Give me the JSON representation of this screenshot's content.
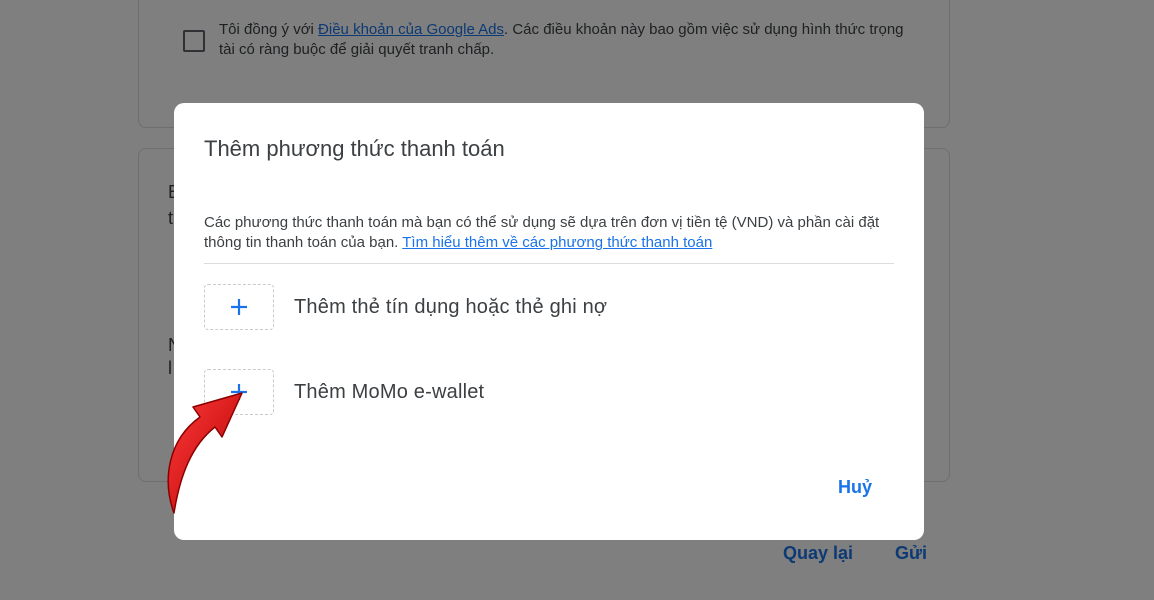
{
  "background": {
    "terms_prefix": "Tôi đồng ý với ",
    "terms_link": "Điều khoản của Google Ads",
    "terms_suffix": ". Các điều khoản này bao gồm việc sử dụng hình thức trọng tài có ràng buộc để giải quyết tranh chấp.",
    "frag_1": "E",
    "frag_2": "t",
    "frag_3": "N",
    "frag_4": "l",
    "back_label": "Quay lại",
    "submit_label": "Gửi"
  },
  "dialog": {
    "title": "Thêm phương thức thanh toán",
    "description": "Các phương thức thanh toán mà bạn có thể sử dụng sẽ dựa trên đơn vị tiền tệ (VND) và phần cài đặt thông tin thanh toán của bạn. ",
    "learn_more_link": "Tìm hiểu thêm về các phương thức thanh toán",
    "options": [
      {
        "label": "Thêm thẻ tín dụng hoặc thẻ ghi nợ",
        "icon": "plus-icon"
      },
      {
        "label": "Thêm MoMo e-wallet",
        "icon": "plus-icon"
      }
    ],
    "cancel_label": "Huỷ"
  },
  "colors": {
    "accent": "#1a73e8",
    "arrow": "#e0151d"
  }
}
